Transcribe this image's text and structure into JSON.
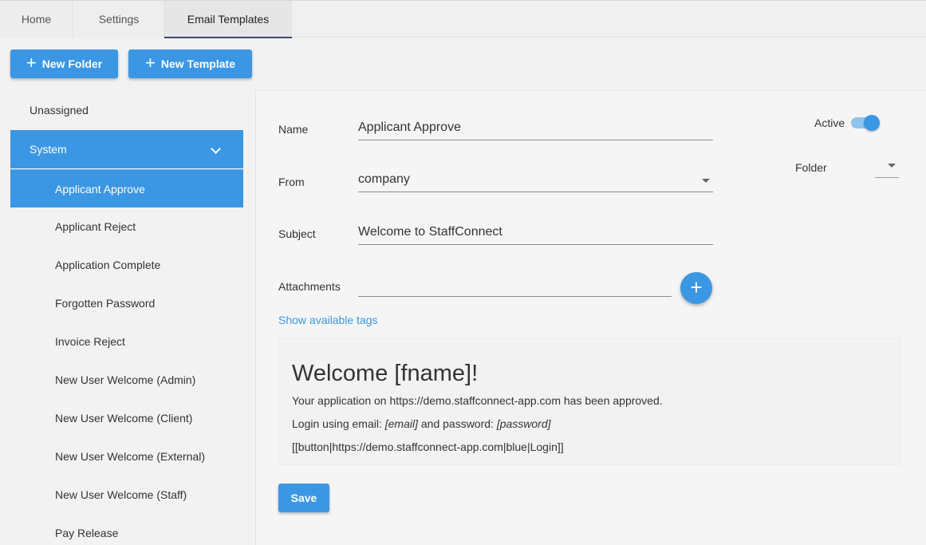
{
  "tabs": [
    {
      "label": "Home"
    },
    {
      "label": "Settings"
    },
    {
      "label": "Email Templates"
    }
  ],
  "toolbar": {
    "new_folder_label": "New Folder",
    "new_template_label": "New Template",
    "plus_glyph": "+"
  },
  "sidebar": {
    "unassigned": "Unassigned",
    "system": "System",
    "items": [
      {
        "label": "Applicant Approve"
      },
      {
        "label": "Applicant Reject"
      },
      {
        "label": "Application Complete"
      },
      {
        "label": "Forgotten Password"
      },
      {
        "label": "Invoice Reject"
      },
      {
        "label": "New User Welcome (Admin)"
      },
      {
        "label": "New User Welcome (Client)"
      },
      {
        "label": "New User Welcome (External)"
      },
      {
        "label": "New User Welcome (Staff)"
      },
      {
        "label": "Pay Release"
      }
    ]
  },
  "form": {
    "name_label": "Name",
    "name_value": "Applicant Approve",
    "from_label": "From",
    "from_value": "company",
    "subject_label": "Subject",
    "subject_value": "Welcome to StaffConnect",
    "attachments_label": "Attachments",
    "attachments_value": "",
    "active_label": "Active",
    "active": true,
    "folder_label": "Folder",
    "folder_value": "",
    "add_glyph": "+",
    "show_tags_label": "Show available tags",
    "save_label": "Save"
  },
  "editor": {
    "heading": "Welcome [fname]!",
    "line1": "Your application on https://demo.staffconnect-app.com has been approved.",
    "line2_prefix": "Login using email: ",
    "line2_email": "[email]",
    "line2_mid": " and password: ",
    "line2_password": "[password]",
    "line3": "[[button|https://demo.staffconnect-app.com|blue|Login]]"
  },
  "colors": {
    "accent": "#3b97e3",
    "accent_light": "#8ec4ee",
    "tab_indicator": "#3b4a6b"
  }
}
